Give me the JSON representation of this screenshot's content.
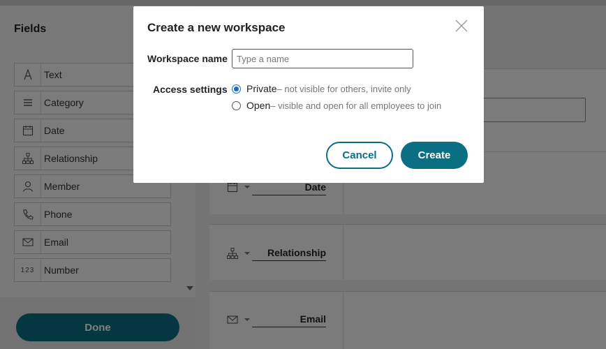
{
  "sidebar": {
    "title": "Fields",
    "items": [
      {
        "label": "Text",
        "icon": "text-icon"
      },
      {
        "label": "Category",
        "icon": "list-icon"
      },
      {
        "label": "Date",
        "icon": "calendar-icon"
      },
      {
        "label": "Relationship",
        "icon": "hierarchy-icon"
      },
      {
        "label": "Member",
        "icon": "person-icon"
      },
      {
        "label": "Phone",
        "icon": "phone-icon"
      },
      {
        "label": "Email",
        "icon": "envelope-icon"
      },
      {
        "label": "Number",
        "icon": "number-icon",
        "glyph": "123"
      }
    ],
    "done_label": "Done"
  },
  "cards": [
    {
      "name": "Date",
      "icon": "calendar-icon"
    },
    {
      "name": "Relationship",
      "icon": "hierarchy-icon"
    },
    {
      "name": "Email",
      "icon": "envelope-icon"
    }
  ],
  "modal": {
    "title": "Create a new workspace",
    "name_label": "Workspace name",
    "name_value": "",
    "name_placeholder": "Type a name",
    "access_label": "Access settings",
    "options": [
      {
        "label": "Private",
        "description": "– not visible for others, invite only",
        "checked": true
      },
      {
        "label": "Open",
        "description": "– visible and open for all employees to join",
        "checked": false
      }
    ],
    "cancel_label": "Cancel",
    "create_label": "Create"
  },
  "colors": {
    "accent": "#0b6f83",
    "radio_selected": "#1a6bc8"
  }
}
